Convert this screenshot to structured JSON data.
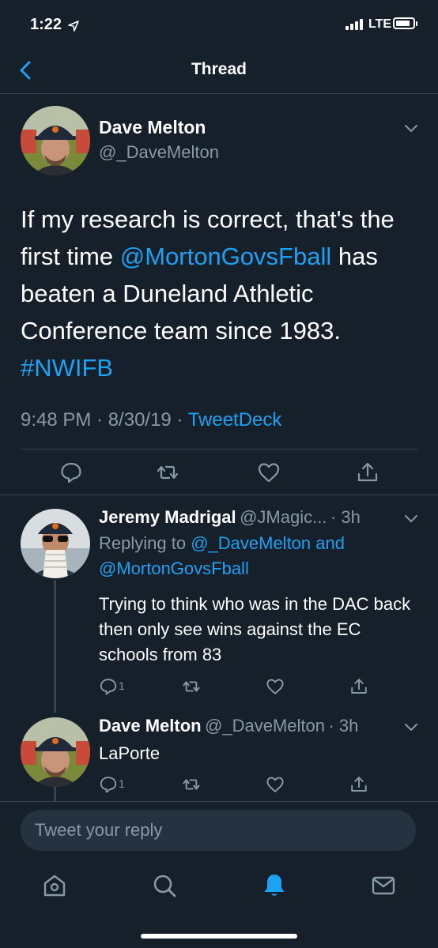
{
  "status_bar": {
    "time": "1:22",
    "network": "LTE"
  },
  "header": {
    "title": "Thread"
  },
  "main_tweet": {
    "name": "Dave Melton",
    "handle": "@_DaveMelton",
    "text_pre": "If my research is correct, that's the first time ",
    "mention": "@MortonGovsFball",
    "text_post": " has beaten a Duneland Athletic Conference team since 1983. ",
    "hashtag": "#NWIFB",
    "time": "9:48 PM · 8/30/19 · ",
    "source": "TweetDeck"
  },
  "replies": [
    {
      "name": "Jeremy Madrigal",
      "handle": "@JMagic...",
      "time": "· 3h",
      "replying_prefix": "Replying to ",
      "replying_to_1": "@_DaveMelton and",
      "replying_to_2": "@MortonGovsFball",
      "text": "Trying to think who was in the DAC back then only see wins against the EC schools from 83",
      "reply_count": "1"
    },
    {
      "name": "Dave Melton",
      "handle": "@_DaveMelton",
      "time": "· 3h",
      "text": "LaPorte",
      "reply_count": "1"
    }
  ],
  "reply_input": {
    "placeholder": "Tweet your reply"
  },
  "colors": {
    "background": "#15202b",
    "accent": "#1da1f2",
    "secondary": "#8899a6",
    "divider": "#38444d"
  },
  "icons": [
    "back-chevron-icon",
    "reply-icon",
    "retweet-icon",
    "like-icon",
    "share-icon",
    "home-icon",
    "search-icon",
    "notifications-icon",
    "messages-icon"
  ]
}
